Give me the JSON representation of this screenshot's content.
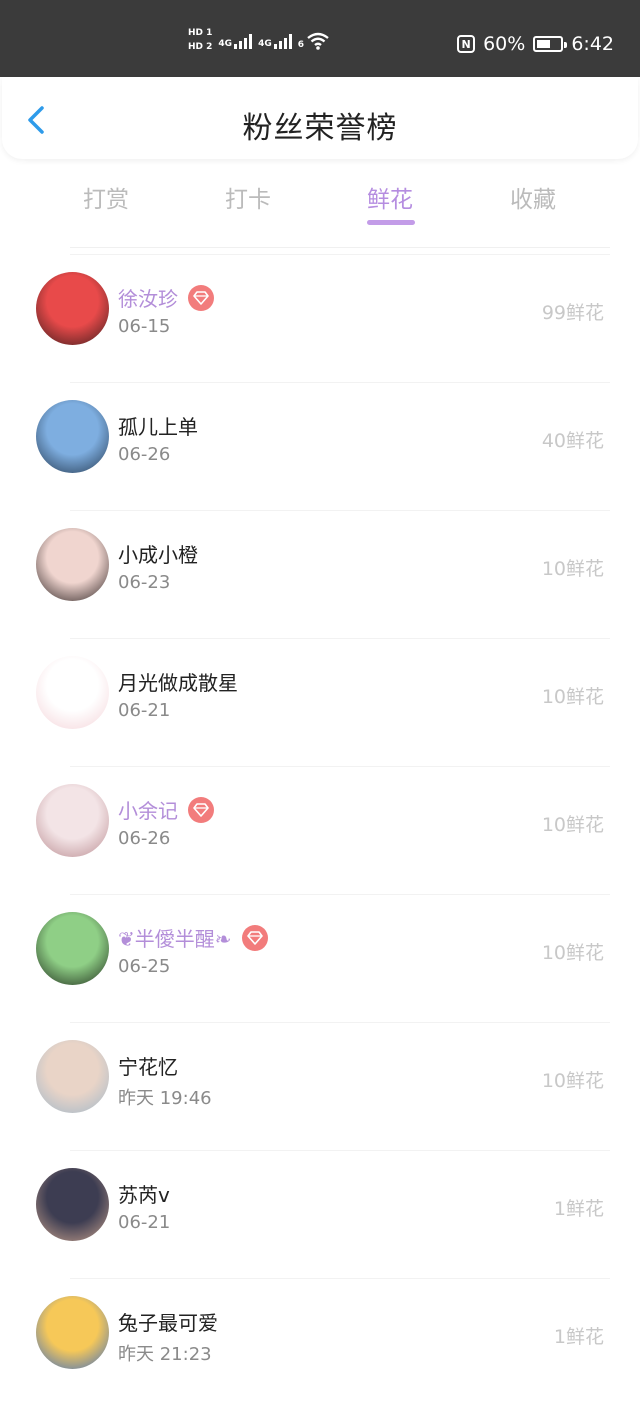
{
  "status_bar": {
    "hd1": "HD 1",
    "hd2": "HD 2",
    "net1": "4G",
    "net2": "4G",
    "wifi_label": "6",
    "nfc": "N",
    "battery": "60%",
    "battery_level": 0.6,
    "time": "6:42"
  },
  "header": {
    "title": "粉丝荣誉榜"
  },
  "tabs": [
    {
      "label": "打赏",
      "active": false
    },
    {
      "label": "打卡",
      "active": false
    },
    {
      "label": "鲜花",
      "active": true
    },
    {
      "label": "收藏",
      "active": false
    }
  ],
  "fans": [
    {
      "name": "徐汝珍",
      "date": "06-15",
      "value": "99鲜花",
      "vip": true,
      "avatar_colors": [
        "#e84a4a",
        "#3b1b1b"
      ]
    },
    {
      "name": "孤儿上单",
      "date": "06-26",
      "value": "40鲜花",
      "vip": false,
      "avatar_colors": [
        "#7eaee0",
        "#22364d"
      ]
    },
    {
      "name": "小成小橙",
      "date": "06-23",
      "value": "10鲜花",
      "vip": false,
      "avatar_colors": [
        "#f0d5cf",
        "#2a2020"
      ]
    },
    {
      "name": "月光做成散星",
      "date": "06-21",
      "value": "10鲜花",
      "vip": false,
      "avatar_colors": [
        "#ffffff",
        "#f4d3d8"
      ]
    },
    {
      "name": "小余记",
      "date": "06-26",
      "value": "10鲜花",
      "vip": true,
      "avatar_colors": [
        "#f3e4e6",
        "#b98b90"
      ]
    },
    {
      "name": "❦半僾半醒❧",
      "date": "06-25",
      "value": "10鲜花",
      "vip": true,
      "avatar_colors": [
        "#8fcf86",
        "#1d2a1a"
      ]
    },
    {
      "name": "宁花忆",
      "date": "昨天 19:46",
      "value": "10鲜花",
      "vip": false,
      "avatar_colors": [
        "#e9d4c7",
        "#9fb7c9"
      ]
    },
    {
      "name": "苏芮v",
      "date": "06-21",
      "value": "1鲜花",
      "vip": false,
      "avatar_colors": [
        "#3d3d52",
        "#c8a28d"
      ]
    },
    {
      "name": "兔子最可爱",
      "date": "昨天 21:23",
      "value": "1鲜花",
      "vip": false,
      "avatar_colors": [
        "#f6c858",
        "#3a6bc4"
      ]
    }
  ]
}
